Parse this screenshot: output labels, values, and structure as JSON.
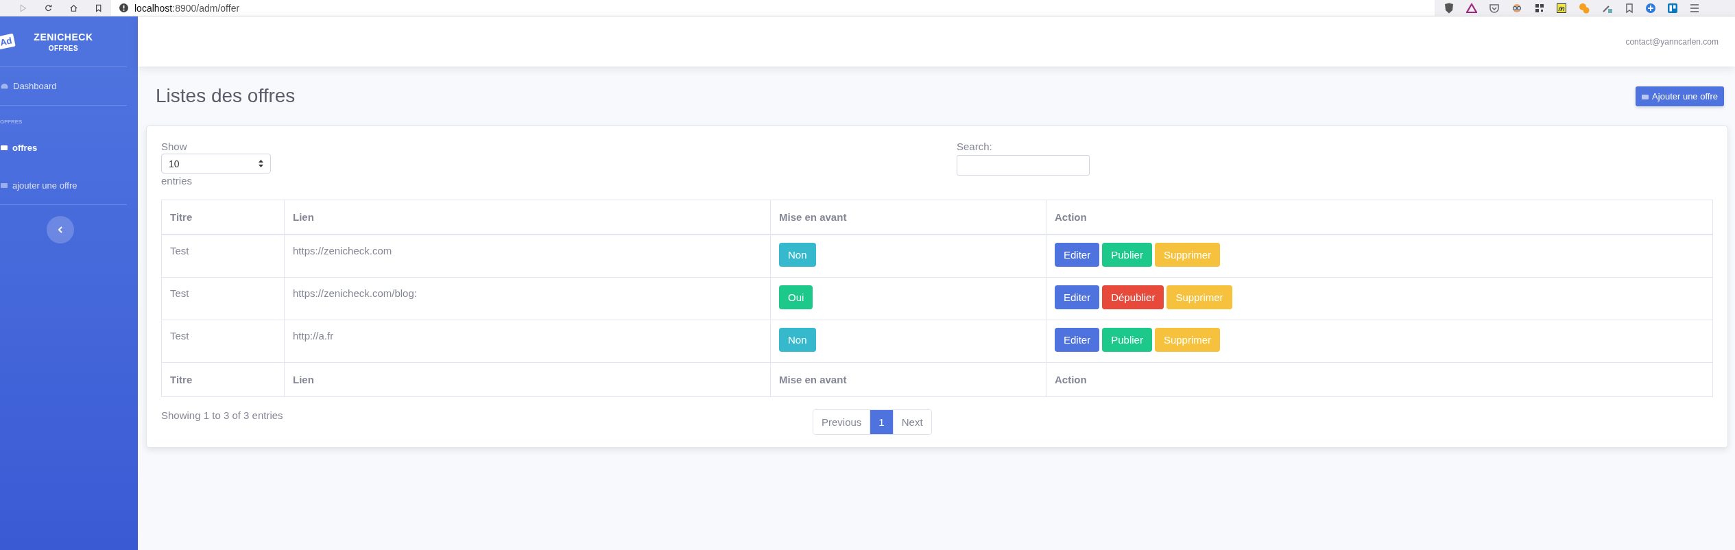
{
  "browser": {
    "url_host": "localhost",
    "url_path": ":8900/adm/offer"
  },
  "sidebar": {
    "brand": "ZENICHECK",
    "brand_sub": "OFFRES",
    "logo": "Ad",
    "section": "OFFRES",
    "items": [
      {
        "label": "Dashboard",
        "selected": false,
        "kind": "dashboard"
      },
      {
        "label": "offres",
        "selected": true,
        "kind": "ad"
      },
      {
        "label": "ajouter une offre",
        "selected": false,
        "kind": "ad"
      }
    ]
  },
  "topbar": {
    "user": "contact@yanncarlen.com"
  },
  "page": {
    "title": "Listes des offres",
    "add_button": "Ajouter une offre"
  },
  "table": {
    "show_label": "Show",
    "page_size": "10",
    "entries_label": "entries",
    "search_label": "Search:",
    "columns": [
      "Titre",
      "Lien",
      "Mise en avant",
      "Action"
    ],
    "rows": [
      {
        "title": "Test",
        "link": "https://zenicheck.com",
        "featured": {
          "label": "Non",
          "on": false
        },
        "actions": [
          {
            "label": "Editer",
            "kind": "edit"
          },
          {
            "label": "Publier",
            "kind": "publish"
          },
          {
            "label": "Supprimer",
            "kind": "delete"
          }
        ]
      },
      {
        "title": "Test",
        "link": "https://zenicheck.com/blog:",
        "featured": {
          "label": "Oui",
          "on": true
        },
        "actions": [
          {
            "label": "Editer",
            "kind": "edit"
          },
          {
            "label": "Dépublier",
            "kind": "unpublish"
          },
          {
            "label": "Supprimer",
            "kind": "delete"
          }
        ]
      },
      {
        "title": "Test",
        "link": "http://a.fr",
        "featured": {
          "label": "Non",
          "on": false
        },
        "actions": [
          {
            "label": "Editer",
            "kind": "edit"
          },
          {
            "label": "Publier",
            "kind": "publish"
          },
          {
            "label": "Supprimer",
            "kind": "delete"
          }
        ]
      }
    ],
    "footer_columns": [
      "Titre",
      "Lien",
      "Mise en avant",
      "Action"
    ],
    "info": "Showing 1 to 3 of 3 entries",
    "pagination": [
      {
        "label": "Previous",
        "selected": false
      },
      {
        "label": "1",
        "selected": true
      },
      {
        "label": "Next",
        "selected": false
      }
    ]
  }
}
